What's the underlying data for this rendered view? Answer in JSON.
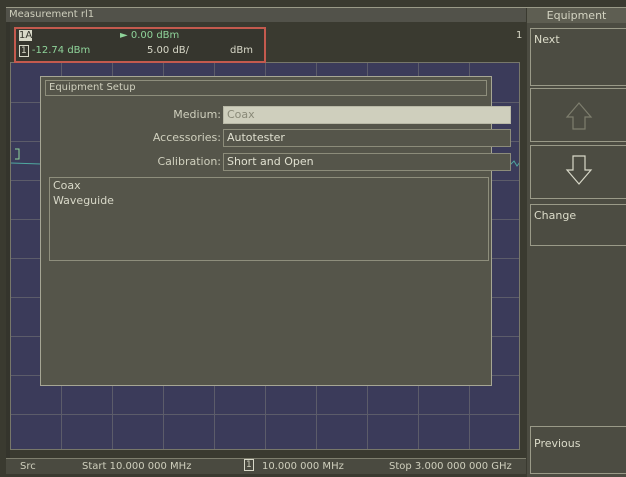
{
  "window": {
    "title": "Measurement rl1"
  },
  "marker": {
    "trace_label": "1A",
    "ref_value": "0.00 dBm",
    "trace_number": "1",
    "marker_value": "-12.74 dBm",
    "scale": "5.00 dB/",
    "unit": "dBm",
    "channel_badge": "1"
  },
  "dialog": {
    "title": "Equipment Setup",
    "fields": [
      {
        "label": "Medium:",
        "value": "Coax"
      },
      {
        "label": "Accessories:",
        "value": "Autotester"
      },
      {
        "label": "Calibration:",
        "value": "Short and Open"
      }
    ],
    "options": [
      "Coax",
      "Waveguide"
    ]
  },
  "softkeys": {
    "title": "Equipment",
    "next": "Next",
    "change": "Change",
    "previous": "Previous"
  },
  "status": {
    "src": "Src",
    "start": "Start 10.000 000 MHz",
    "marker_num": "1",
    "marker_freq": "10.000 000 MHz",
    "stop": "Stop 3.000 000 000 GHz"
  },
  "colors": {
    "marker_border": "#c45a4e",
    "trace": "#4fa8a0",
    "plot_bg": "#3b3b5a"
  }
}
